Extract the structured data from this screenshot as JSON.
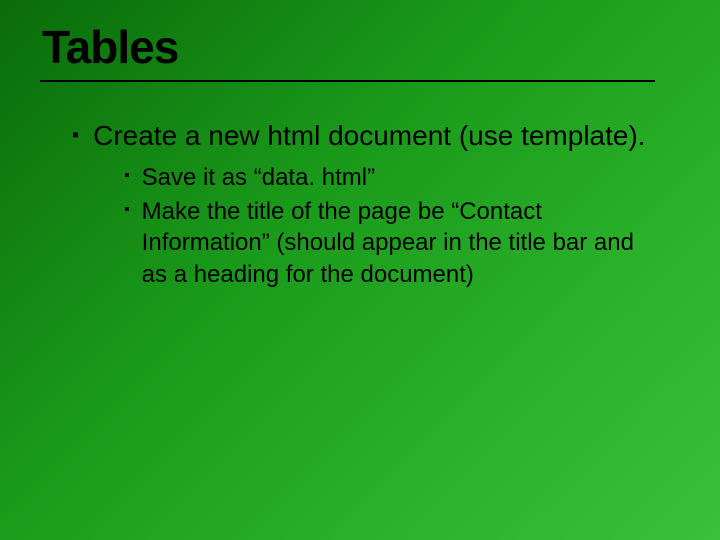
{
  "title": "Tables",
  "bullets": {
    "level1": {
      "item1": "Create a new html document (use template)."
    },
    "level2": {
      "item1": "Save it as “data. html”",
      "item2": "Make the title of the page be “Contact Information” (should appear in the title bar and as a heading for the document)"
    }
  }
}
